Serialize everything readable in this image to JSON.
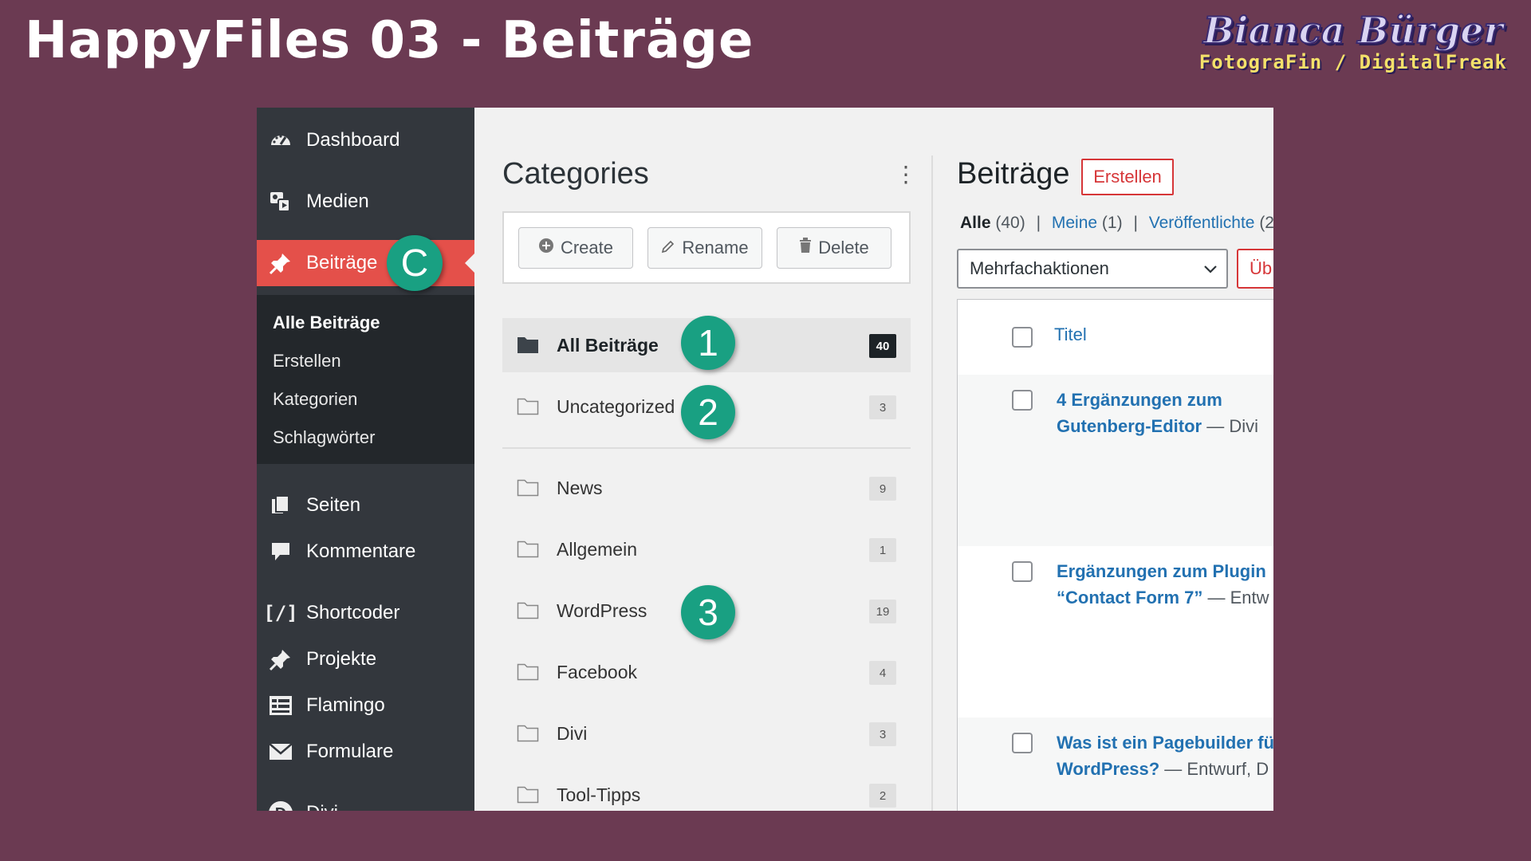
{
  "slide": {
    "title": "HappyFiles 03 - Beiträge",
    "logo": {
      "name": "Bianca Bürger",
      "tagline": "FotograFin / DigitalFreak"
    }
  },
  "sidebar": {
    "items": [
      {
        "label": "Dashboard",
        "icon": "dashboard-icon"
      },
      {
        "label": "Medien",
        "icon": "media-icon"
      },
      {
        "label": "Beiträge",
        "icon": "pin-icon",
        "active": true
      },
      {
        "label": "Seiten",
        "icon": "pages-icon"
      },
      {
        "label": "Kommentare",
        "icon": "comment-icon"
      },
      {
        "label": "Shortcoder",
        "icon": "shortcode-icon"
      },
      {
        "label": "Projekte",
        "icon": "pin-icon"
      },
      {
        "label": "Flamingo",
        "icon": "flamingo-icon"
      },
      {
        "label": "Formulare",
        "icon": "mail-icon"
      },
      {
        "label": "Divi",
        "icon": "divi-icon"
      }
    ],
    "submenu": [
      "Alle Beiträge",
      "Erstellen",
      "Kategorien",
      "Schlagwörter"
    ]
  },
  "annotations": {
    "c": "C",
    "one": "1",
    "two": "2",
    "three": "3"
  },
  "categories": {
    "title": "Categories",
    "menu": "⋮",
    "toolbar": {
      "create": "Create",
      "rename": "Rename",
      "delete": "Delete"
    },
    "items": [
      {
        "name": "All Beiträge",
        "count": "40"
      },
      {
        "name": "Uncategorized",
        "count": "3"
      },
      {
        "name": "News",
        "count": "9"
      },
      {
        "name": "Allgemein",
        "count": "1"
      },
      {
        "name": "WordPress",
        "count": "19"
      },
      {
        "name": "Facebook",
        "count": "4"
      },
      {
        "name": "Divi",
        "count": "3"
      },
      {
        "name": "Tool-Tipps",
        "count": "2"
      }
    ]
  },
  "posts": {
    "title": "Beiträge",
    "create_label": "Erstellen",
    "filters": {
      "all": "Alle",
      "all_count": "(40)",
      "mine": "Meine",
      "mine_count": "(1)",
      "published": "Veröffentlichte",
      "published_count": "(2"
    },
    "bulk_actions": "Mehrfachaktionen",
    "apply_label": "Üb",
    "column_title": "Titel",
    "rows": [
      {
        "title_line1": "4 Ergänzungen zum",
        "title_line2": "Gutenberg-Editor",
        "meta": " — Divi"
      },
      {
        "title_line1": "Ergänzungen zum Plugin",
        "title_line2": "“Contact Form 7”",
        "meta": " — Entw"
      },
      {
        "title_line1": "Was ist ein Pagebuilder fü",
        "title_line2": "WordPress?",
        "meta": " — Entwurf, D"
      }
    ]
  },
  "colors": {
    "background": "#6b3a52",
    "sidebar": "#33373d",
    "active": "#e4504a",
    "badge": "#19a082",
    "link": "#2271b1"
  }
}
